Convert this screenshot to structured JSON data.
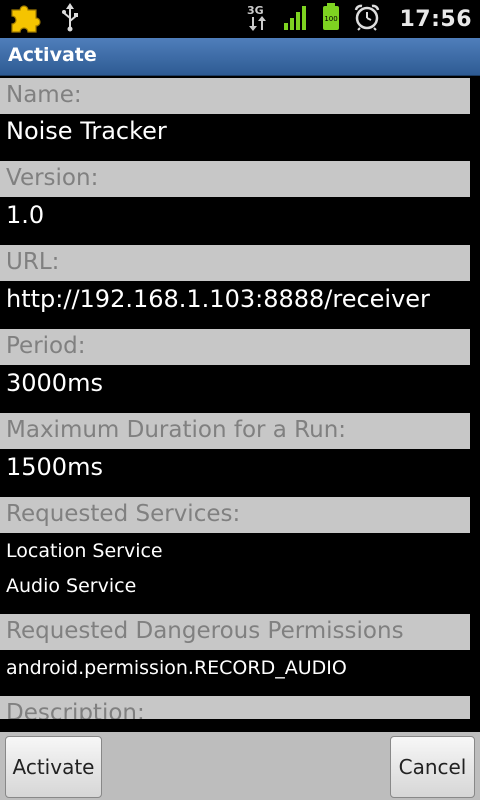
{
  "status_bar": {
    "time": "17:56",
    "network_type": "3G",
    "battery_level": "100",
    "icons": [
      "puzzle-icon",
      "usb-icon",
      "network-3g-icon",
      "signal-icon",
      "battery-icon",
      "alarm-clock-icon"
    ],
    "colors": {
      "signal": "#7ed321",
      "battery": "#7ed321",
      "puzzle": "#f5c400"
    }
  },
  "title_bar": {
    "title": "Activate"
  },
  "fields": [
    {
      "label": "Name:",
      "value": "Noise Tracker"
    },
    {
      "label": "Version:",
      "value": "1.0"
    },
    {
      "label": "URL:",
      "value": "http://192.168.1.103:8888/receiver"
    },
    {
      "label": "Period:",
      "value": "3000ms"
    },
    {
      "label": "Maximum Duration for a Run:",
      "value": "1500ms"
    },
    {
      "label": "Requested Services:",
      "values": [
        "Location Service",
        "Audio Service"
      ]
    },
    {
      "label": "Requested Dangerous Permissions",
      "values": [
        "android.permission.RECORD_AUDIO"
      ]
    },
    {
      "label": "Description:"
    }
  ],
  "buttons": {
    "activate": "Activate",
    "cancel": "Cancel"
  }
}
